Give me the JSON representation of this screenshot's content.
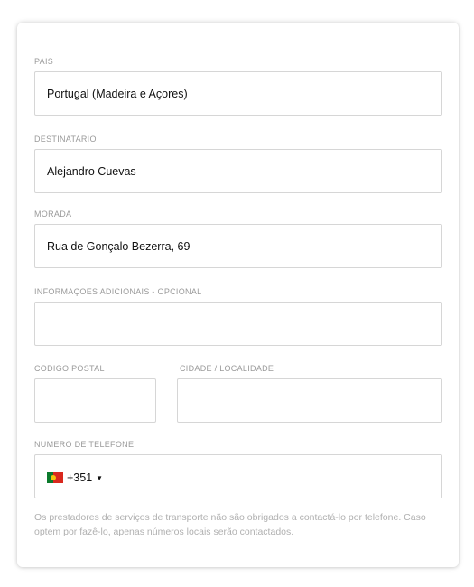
{
  "form": {
    "country": {
      "label": "PAIS",
      "value": "Portugal (Madeira e Açores)"
    },
    "recipient": {
      "label": "DESTINATARIO",
      "value": "Alejandro Cuevas"
    },
    "address": {
      "label": "MORADA",
      "value": "Rua de Gonçalo Bezerra, 69"
    },
    "additional_info": {
      "label": "INFORMAÇOES ADICIONAIS - OPCIONAL",
      "value": ""
    },
    "postal_code": {
      "label": "CODIGO POSTAL",
      "value": ""
    },
    "city": {
      "label": "CIDADE / LOCALIDADE",
      "value": ""
    },
    "phone": {
      "label": "NUMERO DE TELEFONE",
      "dial_code": "+351",
      "flag_icon": "portugal-flag-icon",
      "caret": "▼",
      "value": ""
    },
    "help_text": "Os prestadores de serviços de transporte não são obrigados a contactá-lo por telefone. Caso optem por fazê-lo, apenas números locais serão contactados."
  },
  "colors": {
    "label": "#9a9a9a",
    "border": "#d6d6d6",
    "help": "#b0b0b0",
    "flag_green": "#0b7a2c",
    "flag_red": "#d9281e"
  }
}
